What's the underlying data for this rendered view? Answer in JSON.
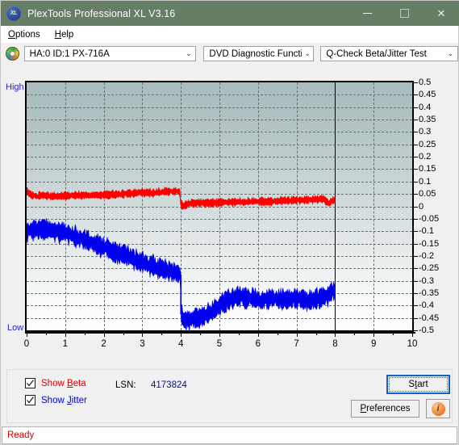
{
  "window": {
    "title": "PlexTools Professional XL V3.16",
    "badge_text": "XL",
    "minimize_label": "Minimize",
    "maximize_label": "Maximize",
    "close_label": "Close",
    "close_glyph": "✕",
    "titlebar_color": "#677e66"
  },
  "menu": {
    "items": [
      {
        "label": "Options",
        "mnemonic": "O",
        "rest": "ptions"
      },
      {
        "label": "Help",
        "mnemonic": "H",
        "rest": "elp"
      }
    ]
  },
  "toolbar": {
    "drive": {
      "value": "HA:0 ID:1  PX-716A",
      "arrow": "⌄"
    },
    "function": {
      "value": "DVD Diagnostic Functions",
      "arrow": "⌄"
    },
    "test": {
      "value": "Q-Check Beta/Jitter Test",
      "arrow": "⌄"
    }
  },
  "controls": {
    "show_beta": {
      "label_mnemonic": "B",
      "label_pre": "Show ",
      "label_post": "eta",
      "checked": true,
      "color": "#dd0000"
    },
    "show_jitter": {
      "label_mnemonic": "J",
      "label_pre": "Show ",
      "label_post": "itter",
      "checked": true,
      "color": "#0000dd"
    },
    "lsn_label": "LSN:",
    "lsn_value": "4173824",
    "start_button": {
      "pre": "S",
      "mnemonic": "t",
      "post": "art",
      "focused": true
    },
    "preferences_button": {
      "pre": "",
      "mnemonic": "P",
      "post": "references"
    },
    "info_button": {
      "glyph": "i",
      "name": "information"
    }
  },
  "status": {
    "text": "Ready",
    "color": "#cc0000"
  },
  "chart_data": {
    "type": "line",
    "title": "",
    "xlabel": "",
    "ylabel": "",
    "xlim": [
      0,
      10
    ],
    "ylim": [
      -0.5,
      0.5
    ],
    "grid": true,
    "legend_position": "below-left",
    "y_axis_side": "right",
    "y_high_label": "High",
    "y_low_label": "Low",
    "x_ticks": [
      0,
      1,
      2,
      3,
      4,
      5,
      6,
      7,
      8,
      9,
      10
    ],
    "y_ticks": [
      0.5,
      0.45,
      0.4,
      0.35,
      0.3,
      0.25,
      0.2,
      0.15,
      0.1,
      0.05,
      0,
      -0.05,
      -0.1,
      -0.15,
      -0.2,
      -0.25,
      -0.3,
      -0.35,
      -0.4,
      -0.45,
      -0.5
    ],
    "data_end_x": 8,
    "layer_break_x": 4,
    "series": [
      {
        "name": "Beta",
        "color": "#ff0000",
        "noise_amplitude": 0.012,
        "x": [
          0.0,
          0.1,
          0.25,
          0.4,
          0.6,
          0.8,
          1.0,
          1.25,
          1.5,
          1.75,
          2.0,
          2.25,
          2.5,
          2.75,
          3.0,
          3.25,
          3.5,
          3.7,
          3.9,
          3.97,
          4.0,
          4.05,
          4.2,
          4.5,
          4.8,
          5.1,
          5.4,
          5.7,
          6.0,
          6.3,
          6.6,
          6.9,
          7.2,
          7.5,
          7.7,
          7.85,
          7.92,
          8.0
        ],
        "values": [
          0.06,
          0.048,
          0.04,
          0.044,
          0.042,
          0.041,
          0.043,
          0.045,
          0.046,
          0.045,
          0.047,
          0.048,
          0.05,
          0.052,
          0.056,
          0.054,
          0.058,
          0.06,
          0.062,
          0.06,
          0.01,
          0.0,
          0.012,
          0.014,
          0.013,
          0.016,
          0.018,
          0.017,
          0.02,
          0.019,
          0.022,
          0.024,
          0.026,
          0.028,
          0.03,
          0.01,
          0.024,
          0.026
        ]
      },
      {
        "name": "Jitter",
        "color": "#0000ee",
        "noise_amplitude": 0.03,
        "x": [
          0.0,
          0.15,
          0.35,
          0.55,
          0.75,
          1.0,
          1.25,
          1.5,
          1.75,
          2.0,
          2.25,
          2.5,
          2.75,
          3.0,
          3.25,
          3.5,
          3.7,
          3.85,
          3.95,
          3.99,
          4.0,
          4.08,
          4.2,
          4.4,
          4.6,
          4.8,
          5.0,
          5.2,
          5.5,
          5.8,
          6.1,
          6.4,
          6.7,
          7.0,
          7.3,
          7.55,
          7.75,
          7.9,
          8.0
        ],
        "values": [
          -0.105,
          -0.095,
          -0.092,
          -0.095,
          -0.1,
          -0.108,
          -0.12,
          -0.135,
          -0.15,
          -0.165,
          -0.18,
          -0.195,
          -0.21,
          -0.225,
          -0.24,
          -0.252,
          -0.262,
          -0.268,
          -0.272,
          -0.275,
          -0.43,
          -0.455,
          -0.46,
          -0.452,
          -0.44,
          -0.425,
          -0.4,
          -0.378,
          -0.365,
          -0.372,
          -0.38,
          -0.372,
          -0.378,
          -0.37,
          -0.382,
          -0.372,
          -0.365,
          -0.348,
          -0.34
        ]
      }
    ]
  }
}
